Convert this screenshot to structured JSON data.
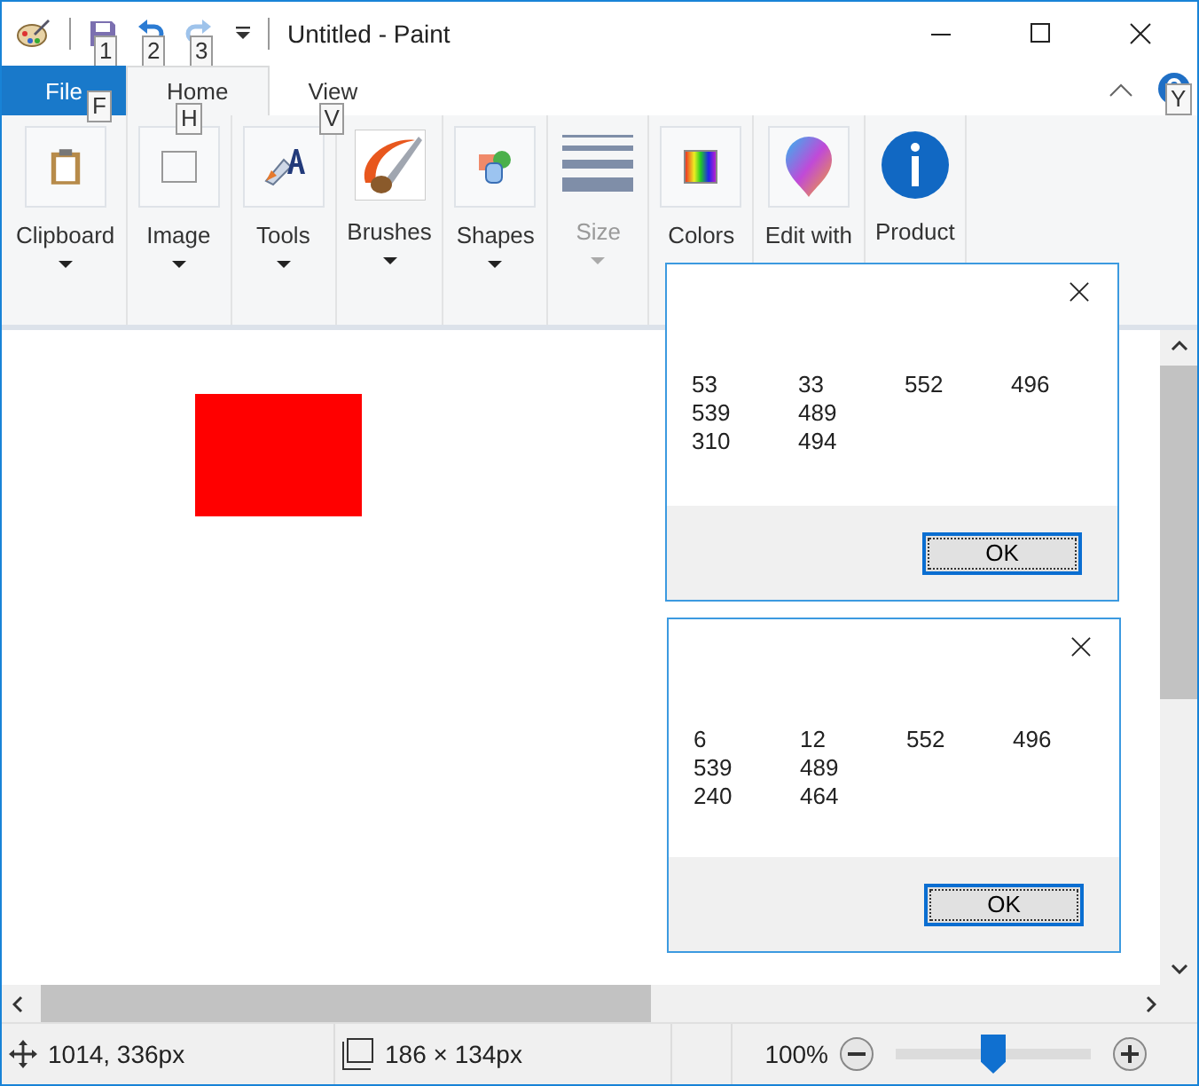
{
  "window": {
    "title": "Untitled - Paint"
  },
  "quick_access": [
    {
      "kind": "save",
      "keytip": "1",
      "disabled": false
    },
    {
      "kind": "undo",
      "keytip": "2",
      "disabled": false
    },
    {
      "kind": "redo",
      "keytip": "3",
      "disabled": true
    }
  ],
  "tabs": [
    {
      "label": "File",
      "kind": "file",
      "selected": false,
      "keytip": "F"
    },
    {
      "label": "Home",
      "kind": "tab",
      "selected": true,
      "keytip": "H"
    },
    {
      "label": "View",
      "kind": "tab",
      "selected": false,
      "keytip": "V"
    }
  ],
  "help_keytip": "Y",
  "ribbon": {
    "groups": [
      {
        "label": "Clipboard",
        "kind": "clipboard",
        "caret": true,
        "disabled": false
      },
      {
        "label": "Image",
        "kind": "image",
        "caret": true,
        "disabled": false
      },
      {
        "label": "Tools",
        "kind": "tools",
        "caret": true,
        "disabled": false
      },
      {
        "label": "Brushes",
        "kind": "brushes",
        "caret": true,
        "disabled": false
      },
      {
        "label": "Shapes",
        "kind": "shapes",
        "caret": true,
        "disabled": false
      },
      {
        "label": "Size",
        "kind": "size",
        "caret": true,
        "disabled": true
      },
      {
        "label": "Colors",
        "kind": "colors",
        "caret": false,
        "disabled": false
      },
      {
        "label": "Edit with",
        "kind": "paint3d",
        "caret": false,
        "disabled": false
      },
      {
        "label": "Product",
        "kind": "alert",
        "caret": false,
        "disabled": false
      }
    ]
  },
  "dialogs": [
    {
      "rows": [
        [
          "53",
          "33",
          "552",
          "496"
        ],
        [
          "539",
          "489"
        ],
        [
          "310",
          "494"
        ]
      ],
      "button": "OK"
    },
    {
      "rows": [
        [
          "6",
          "12",
          "552",
          "496"
        ],
        [
          "539",
          "489"
        ],
        [
          "240",
          "464"
        ]
      ],
      "button": "OK"
    }
  ],
  "status_bar": {
    "cursor": "1014, 336px",
    "selection": "186 × 134px",
    "zoom": "100%",
    "zoom_slider": {
      "level": 0.5
    }
  }
}
